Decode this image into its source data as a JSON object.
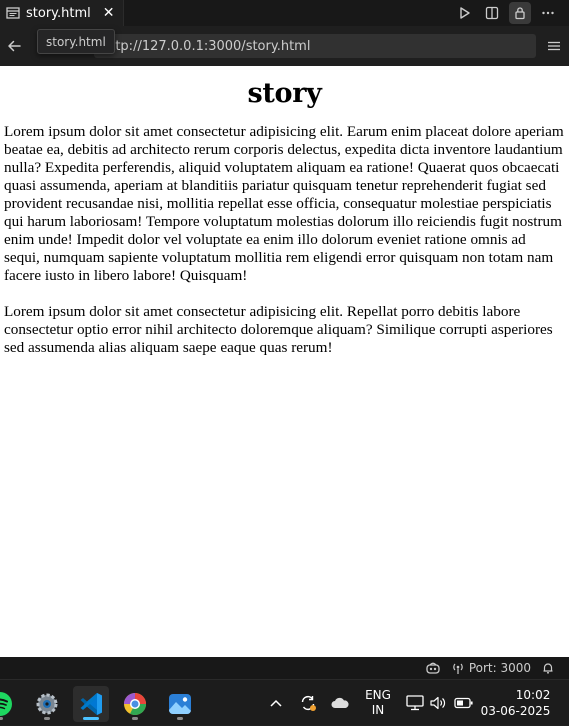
{
  "editor": {
    "tab": {
      "label": "story.html",
      "close": "✕"
    },
    "tooltip": "story.html",
    "url": "http://127.0.0.1:3000/story.html"
  },
  "page": {
    "heading": "story",
    "paragraphs": [
      "Lorem ipsum dolor sit amet consectetur adipisicing elit. Earum enim placeat dolore aperiam beatae ea, debitis ad architecto rerum corporis delectus, expedita dicta inventore laudantium nulla? Expedita perferendis, aliquid voluptatem aliquam ea ratione! Quaerat quos obcaecati quasi assumenda, aperiam at blanditiis pariatur quisquam tenetur reprehenderit fugiat sed provident recusandae nisi, mollitia repellat esse officia, consequatur molestiae perspiciatis qui harum laboriosam! Tempore voluptatum molestias dolorum illo reiciendis fugit nostrum enim unde! Impedit dolor vel voluptate ea enim illo dolorum eveniet ratione omnis ad sequi, numquam sapiente voluptatum mollitia rem eligendi error quisquam non totam nam facere iusto in libero labore! Quisquam!",
      "Lorem ipsum dolor sit amet consectetur adipisicing elit. Repellat porro debitis labore consectetur optio error nihil architecto doloremque aliquam? Similique corrupti asperiores sed assumenda alias aliquam saepe eaque quas rerum!"
    ]
  },
  "statusbar": {
    "port": "Port: 3000"
  },
  "taskbar": {
    "apps": [
      "spotify-icon",
      "settings-icon",
      "vscode-icon",
      "browser-icon",
      "photos-icon"
    ],
    "language": {
      "line1": "ENG",
      "line2": "IN"
    },
    "time": "10:02",
    "date": "03-06-2025"
  },
  "colors": {
    "accent": "#4cc2ff",
    "editor_bg": "#1f1f1f",
    "page_bg": "#ffffff"
  }
}
